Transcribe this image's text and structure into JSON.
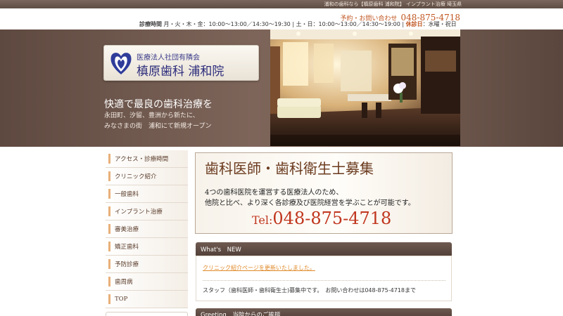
{
  "top_bar": {
    "text": "浦和の歯科なら【槙原歯科 浦和院】 インプラント治療 埼玉県"
  },
  "contact": {
    "label": "予約・お問い合わせ",
    "phone": "048-875-4718"
  },
  "hours": {
    "label": "診療時間",
    "weekday": "月・火・木・金：10:00～13:00／14:30～19:30",
    "saturday": "土・日：10:00～13:00／14:30～19:00",
    "holiday_label": "休診日",
    "holiday": "：水曜・祝日"
  },
  "logo": {
    "subtitle": "医療法人社団有隣会",
    "name": "槙原歯科 浦和院"
  },
  "hero": {
    "tagline": "快適で最良の歯科治療を",
    "desc_line1": "永田町、汐留、豊洲から新たに、",
    "desc_line2": "みなさまの街　浦和にて新規オープン"
  },
  "nav": {
    "items": [
      {
        "label": "アクセス・診療時間"
      },
      {
        "label": "クリニック紹介"
      },
      {
        "label": "一般歯科"
      },
      {
        "label": "インプラント治療"
      },
      {
        "label": "審美治療"
      },
      {
        "label": "矯正歯科"
      },
      {
        "label": "予防診療"
      },
      {
        "label": "歯周病"
      },
      {
        "label": "TOP"
      }
    ]
  },
  "recruit": {
    "title": "歯科医師・歯科衛生士募集",
    "body_line1": "4つの歯科医院を運営する医療法人のため、",
    "body_line2": "他院と比べ、より深く各診療及び医院経営を学ぶことが可能です。",
    "tel_prefix": "Tel:",
    "tel": "048-875-4718"
  },
  "news": {
    "title": "What's　NEW",
    "items": [
      "クリニック紹介ページを更新いたしました。",
      "スタッフ（歯科医師・歯科衛生士)募集中です。　お問い合わせは048-875-4718まで"
    ]
  },
  "greeting": {
    "title": "Greeting　当院からのご挨拶"
  }
}
